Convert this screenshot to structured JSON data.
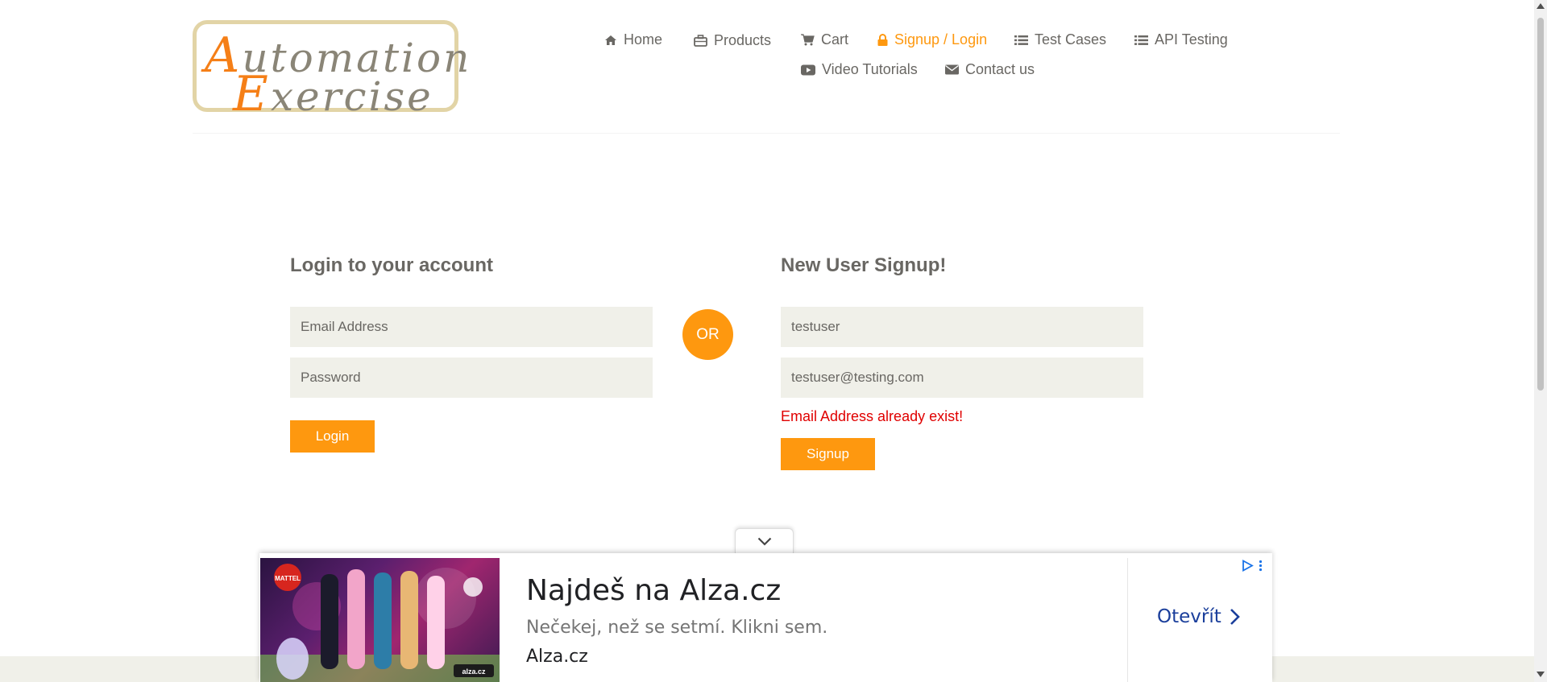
{
  "logo": {
    "line1_cap": "A",
    "line1_rest": "utomation",
    "line2_cap": "E",
    "line2_rest": "xercise"
  },
  "nav": {
    "items": [
      {
        "label": "Home",
        "icon": "home-icon"
      },
      {
        "label": "Products",
        "icon": "briefcase-icon"
      },
      {
        "label": "Cart",
        "icon": "cart-icon"
      },
      {
        "label": "Signup / Login",
        "icon": "lock-icon",
        "active": true
      },
      {
        "label": "Test Cases",
        "icon": "list-icon"
      },
      {
        "label": "API Testing",
        "icon": "list-icon"
      },
      {
        "label": "Video Tutorials",
        "icon": "youtube-play-icon"
      },
      {
        "label": "Contact us",
        "icon": "envelope-icon"
      }
    ],
    "active_color": "#fe980f"
  },
  "login": {
    "title": "Login to your account",
    "email_placeholder": "Email Address",
    "password_placeholder": "Password",
    "button_label": "Login"
  },
  "divider": {
    "label": "OR"
  },
  "signup": {
    "title": "New User Signup!",
    "name_value": "testuser",
    "email_value": "testuser@testing.com",
    "error_message": "Email Address already exist!",
    "button_label": "Signup"
  },
  "ad": {
    "title": "Najdeš na Alza.cz",
    "description": "Nečekej, než se setmí. Klikni sem.",
    "domain": "Alza.cz",
    "cta_label": "Otevřít",
    "image_brand_badge": "MATTEL",
    "image_logo": "alza.cz"
  },
  "colors": {
    "accent": "#fe980f",
    "field_bg": "#f0f0e9",
    "error": "#e00000",
    "ad_cta": "#1a3e9b"
  }
}
